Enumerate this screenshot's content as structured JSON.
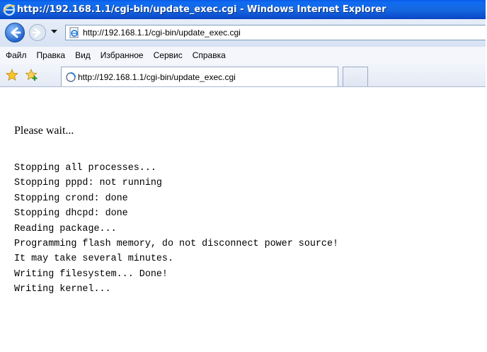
{
  "window": {
    "title": "http://192.168.1.1/cgi-bin/update_exec.cgi - Windows Internet Explorer"
  },
  "address_bar": {
    "url": "http://192.168.1.1/cgi-bin/update_exec.cgi"
  },
  "menu": {
    "items": [
      "Файл",
      "Правка",
      "Вид",
      "Избранное",
      "Сервис",
      "Справка"
    ]
  },
  "tabs": [
    {
      "title": "http://192.168.1.1/cgi-bin/update_exec.cgi",
      "icon": "loading-page-icon"
    }
  ],
  "page": {
    "heading": "Please wait...",
    "log_lines": [
      "Stopping all processes...",
      "Stopping pppd: not running",
      "Stopping crond: done",
      "Stopping dhcpd: done",
      "Reading package...",
      "Programming flash memory, do not disconnect power source!",
      "It may take several minutes.",
      "Writing filesystem... Done!",
      "Writing kernel..."
    ]
  },
  "colors": {
    "titlebar": "#0c5ce0",
    "title_text": "#ffffff",
    "toolbar_bg": "#dfe7f4"
  }
}
